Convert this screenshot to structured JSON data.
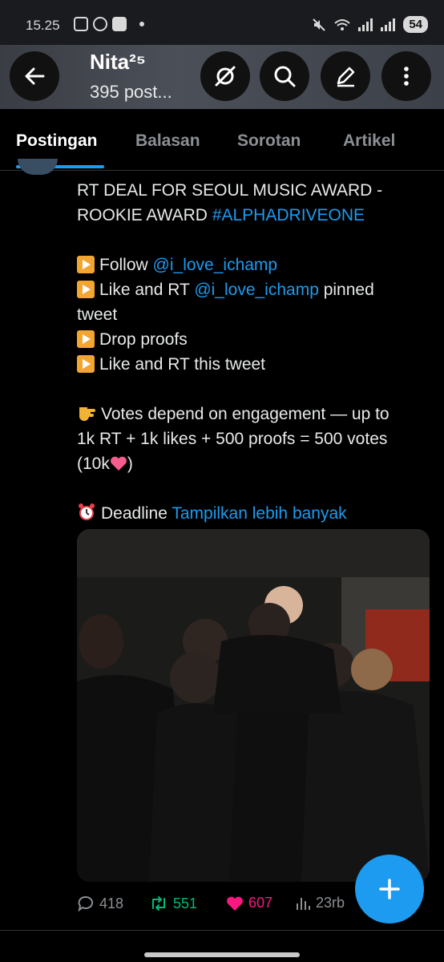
{
  "status_bar": {
    "time": "15.25",
    "battery": "54"
  },
  "header": {
    "title": "Nita²⁵",
    "subtitle": "395 post..."
  },
  "tabs": [
    {
      "label": "Postingan",
      "active": true
    },
    {
      "label": "Balasan",
      "active": false
    },
    {
      "label": "Sorotan",
      "active": false
    },
    {
      "label": "Artikel",
      "active": false
    }
  ],
  "tweet": {
    "line1": "RT DEAL FOR SEOUL MUSIC AWARD -",
    "line2_prefix": "ROOKIE AWARD ",
    "hashtag": "#ALPHADRIVEONE",
    "step1_prefix": "Follow ",
    "step1_mention": "@i_love_ichamp",
    "step2_prefix": "Like and RT ",
    "step2_mention": "@i_love_ichamp",
    "step2_suffix": " pinned",
    "step2_line2": "tweet",
    "step3": "Drop proofs",
    "step4": "Like and RT this tweet",
    "votes_line1": "Votes depend on engagement — up to",
    "votes_line2": "1k RT + 1k likes + 500 proofs = 500 votes",
    "votes_line3_text": "(10k",
    "votes_line3_end": ")",
    "deadline_prefix": "Deadline ",
    "show_more": "Tampilkan lebih banyak"
  },
  "actions": {
    "replies": "418",
    "reposts": "551",
    "likes": "607",
    "views": "23rb"
  },
  "colors": {
    "accent": "#1d9bf0",
    "repost": "#00ba7c",
    "like": "#f91880",
    "muted": "#8b8f94"
  }
}
